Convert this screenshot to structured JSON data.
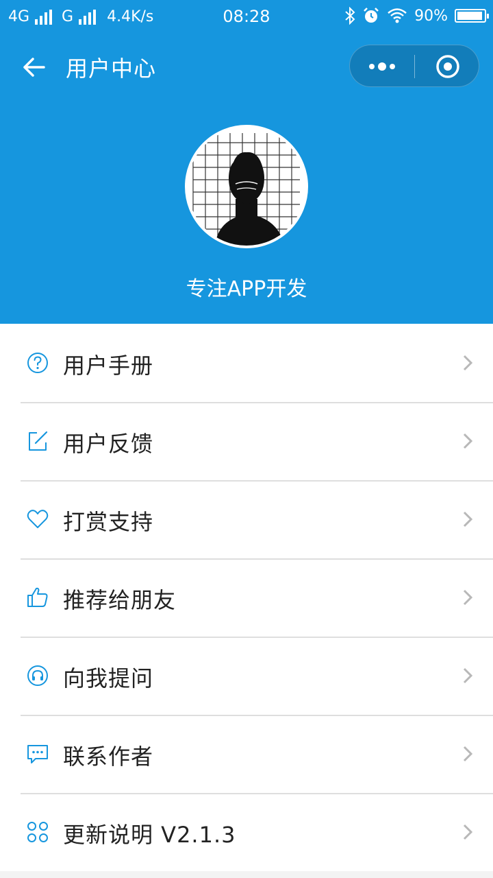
{
  "status_bar": {
    "network_1": "4G",
    "network_2": "G",
    "speed": "4.4K/s",
    "time": "08:28",
    "battery": "90%"
  },
  "nav": {
    "title": "用户中心"
  },
  "profile": {
    "name": "专注APP开发"
  },
  "menu": {
    "items": [
      {
        "label": "用户手册",
        "icon": "help-circle-icon"
      },
      {
        "label": "用户反馈",
        "icon": "edit-icon"
      },
      {
        "label": "打赏支持",
        "icon": "heart-icon"
      },
      {
        "label": "推荐给朋友",
        "icon": "thumbs-up-icon"
      },
      {
        "label": "向我提问",
        "icon": "headset-icon"
      },
      {
        "label": "联系作者",
        "icon": "chat-icon"
      },
      {
        "label": "更新说明 V2.1.3",
        "icon": "grid-icon"
      }
    ]
  },
  "colors": {
    "accent": "#1696de",
    "icon": "#1696de"
  }
}
